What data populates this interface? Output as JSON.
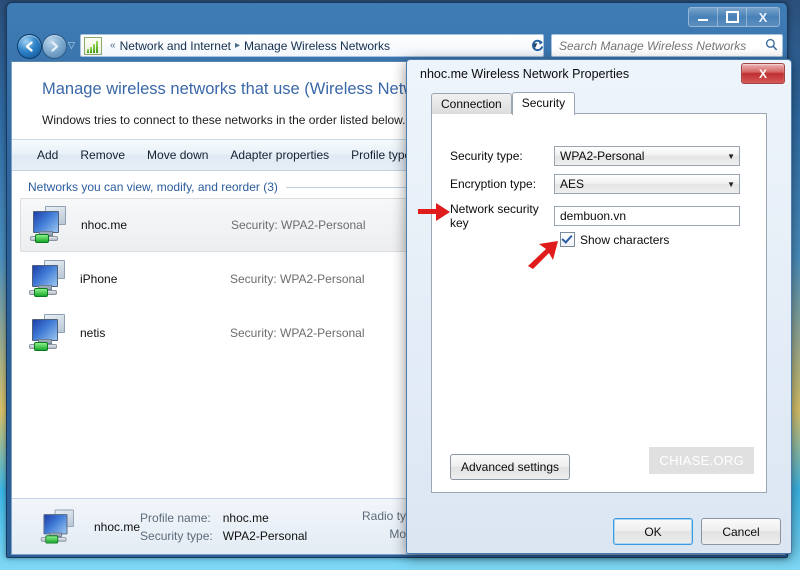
{
  "window": {
    "controls": {
      "minimize": "minimize-button",
      "maximize": "maximize-button",
      "close": "close-button",
      "close_glyph": "X"
    },
    "nav": {
      "back_glyph": "←",
      "forward_glyph": "→",
      "history_glyph": "▽",
      "dropdown_glyph": "▼",
      "refresh_glyph": "↻",
      "breadcrumb_separator_first": "«",
      "breadcrumb": [
        "Network and Internet",
        "Manage Wireless Networks"
      ]
    },
    "search": {
      "placeholder": "Search Manage Wireless Networks",
      "value": "",
      "icon_glyph": "⌕"
    }
  },
  "content": {
    "title": "Manage wireless networks that use (Wireless Network",
    "subtitle": "Windows tries to connect to these networks in the order listed below.",
    "toolbar": [
      "Add",
      "Remove",
      "Move down",
      "Adapter properties",
      "Profile types"
    ],
    "list_header": "Networks you can view, modify, and reorder (3)",
    "security_label": "Security:",
    "networks": [
      {
        "name": "nhoc.me",
        "security": "WPA2-Personal",
        "selected": true
      },
      {
        "name": "iPhone",
        "security": "WPA2-Personal",
        "selected": false
      },
      {
        "name": "netis",
        "security": "WPA2-Personal",
        "selected": false
      }
    ]
  },
  "details": {
    "name": "nhoc.me",
    "rows": [
      {
        "label": "Profile name:",
        "value": "nhoc.me"
      },
      {
        "label": "Security type:",
        "value": "WPA2-Personal"
      }
    ],
    "right_rows": [
      "Radio type",
      "Mode"
    ]
  },
  "dialog": {
    "title": "nhoc.me Wireless Network Properties",
    "close_glyph": "X",
    "tabs": [
      {
        "label": "Connection",
        "active": false
      },
      {
        "label": "Security",
        "active": true
      }
    ],
    "fields": {
      "security_type_label": "Security type:",
      "security_type_value": "WPA2-Personal",
      "encryption_type_label": "Encryption type:",
      "encryption_type_value": "AES",
      "network_key_label": "Network security key",
      "network_key_value": "dembuon.vn",
      "show_characters_label": "Show characters",
      "show_characters_checked": true,
      "dropdown_glyph": "▼"
    },
    "advanced_settings_label": "Advanced settings",
    "watermark": "CHIASE.ORG",
    "buttons": {
      "ok": "OK",
      "cancel": "Cancel"
    }
  },
  "colors": {
    "accent_blue": "#2b5c9e",
    "title_blue": "#3a67a8",
    "close_red": "#bf2f2f",
    "annotation_red": "#e01b1b"
  }
}
